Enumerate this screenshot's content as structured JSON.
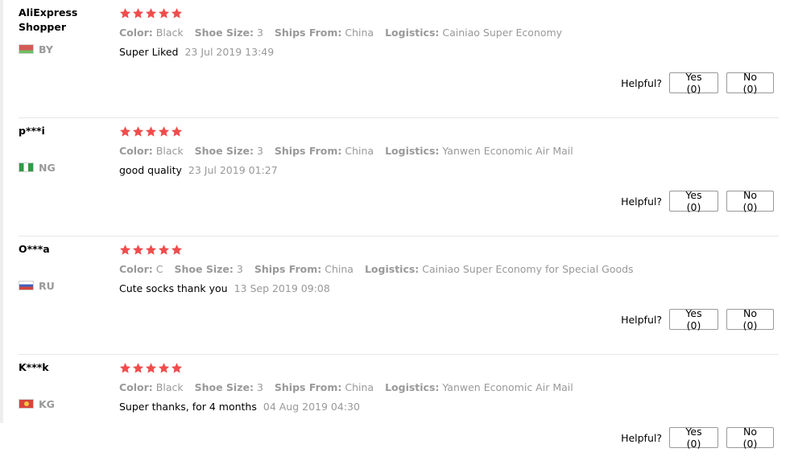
{
  "reviews": [
    {
      "user_name": "AliExpress Shopper",
      "country_code": "BY",
      "country_flag": "flag-by",
      "stars": 5,
      "attributes": [
        {
          "label": "Color:",
          "value": "Black"
        },
        {
          "label": "Shoe Size:",
          "value": "3"
        },
        {
          "label": "Ships From:",
          "value": "China"
        },
        {
          "label": "Logistics:",
          "value": "Cainiao Super Economy"
        }
      ],
      "text": "Super Liked",
      "date": "23 Jul 2019 13:49",
      "helpful_label": "Helpful?",
      "yes_label": "Yes (0)",
      "no_label": "No (0)"
    },
    {
      "user_name": "p***i",
      "country_code": "NG",
      "country_flag": "flag-ng",
      "stars": 5,
      "attributes": [
        {
          "label": "Color:",
          "value": "Black"
        },
        {
          "label": "Shoe Size:",
          "value": "3"
        },
        {
          "label": "Ships From:",
          "value": "China"
        },
        {
          "label": "Logistics:",
          "value": "Yanwen Economic Air Mail"
        }
      ],
      "text": "good quality",
      "date": "23 Jul 2019 01:27",
      "helpful_label": "Helpful?",
      "yes_label": "Yes (0)",
      "no_label": "No (0)"
    },
    {
      "user_name": "O***a",
      "country_code": "RU",
      "country_flag": "flag-ru",
      "stars": 5,
      "attributes": [
        {
          "label": "Color:",
          "value": "C"
        },
        {
          "label": "Shoe Size:",
          "value": "3"
        },
        {
          "label": "Ships From:",
          "value": "China"
        },
        {
          "label": "Logistics:",
          "value": "Cainiao Super Economy for Special Goods"
        }
      ],
      "text": "Cute socks thank you",
      "date": "13 Sep 2019 09:08",
      "helpful_label": "Helpful?",
      "yes_label": "Yes (0)",
      "no_label": "No (0)"
    },
    {
      "user_name": "K***k",
      "country_code": "KG",
      "country_flag": "flag-kg",
      "stars": 5,
      "attributes": [
        {
          "label": "Color:",
          "value": "Black"
        },
        {
          "label": "Shoe Size:",
          "value": "3"
        },
        {
          "label": "Ships From:",
          "value": "China"
        },
        {
          "label": "Logistics:",
          "value": "Yanwen Economic Air Mail"
        }
      ],
      "text": "Super thanks, for 4 months",
      "date": "04 Aug 2019 04:30",
      "helpful_label": "Helpful?",
      "yes_label": "Yes (0)",
      "no_label": "No (0)"
    }
  ],
  "colors": {
    "star": "#f04c4c",
    "muted_text": "#999999",
    "divider": "#e6e6e6"
  }
}
